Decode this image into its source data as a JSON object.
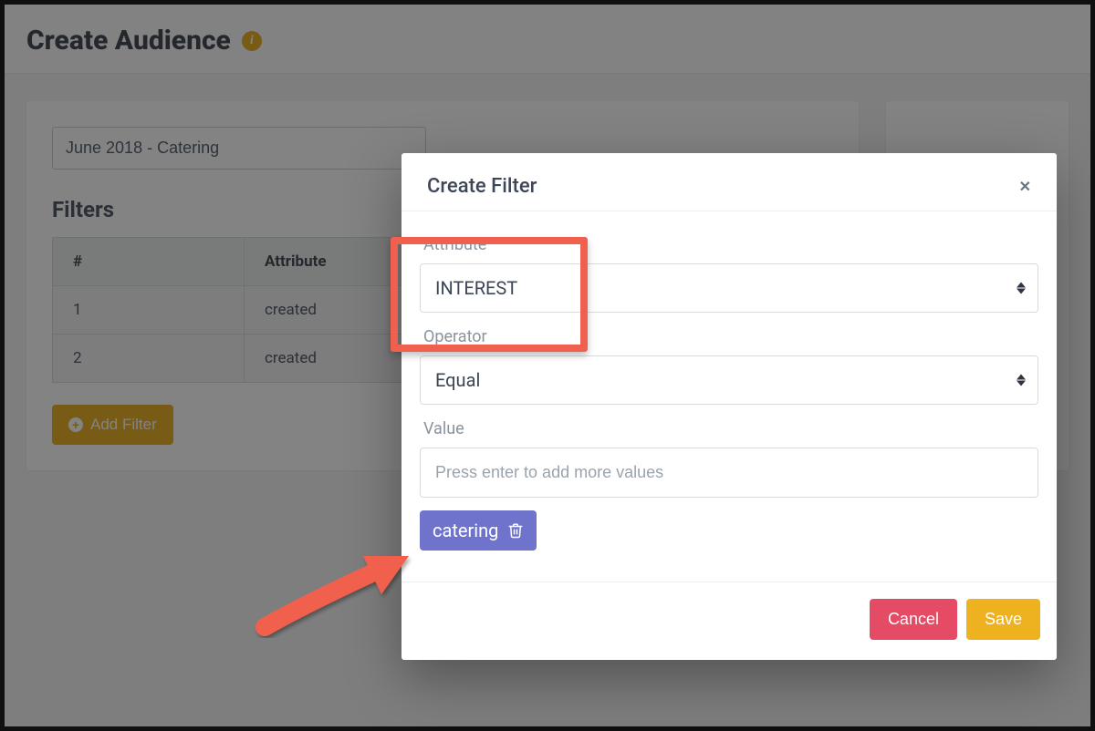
{
  "header": {
    "title": "Create Audience"
  },
  "audience": {
    "name": "June 2018 - Catering"
  },
  "filters": {
    "section_title": "Filters",
    "columns": {
      "num": "#",
      "attribute": "Attribute"
    },
    "rows": [
      {
        "num": "1",
        "attribute": "created"
      },
      {
        "num": "2",
        "attribute": "created"
      }
    ],
    "add_label": "Add Filter"
  },
  "modal": {
    "title": "Create Filter",
    "attribute_label": "Attribute",
    "attribute_value": "INTEREST",
    "operator_label": "Operator",
    "operator_value": "Equal",
    "value_label": "Value",
    "value_placeholder": "Press enter to add more values",
    "chip_label": "catering",
    "cancel_label": "Cancel",
    "save_label": "Save"
  }
}
